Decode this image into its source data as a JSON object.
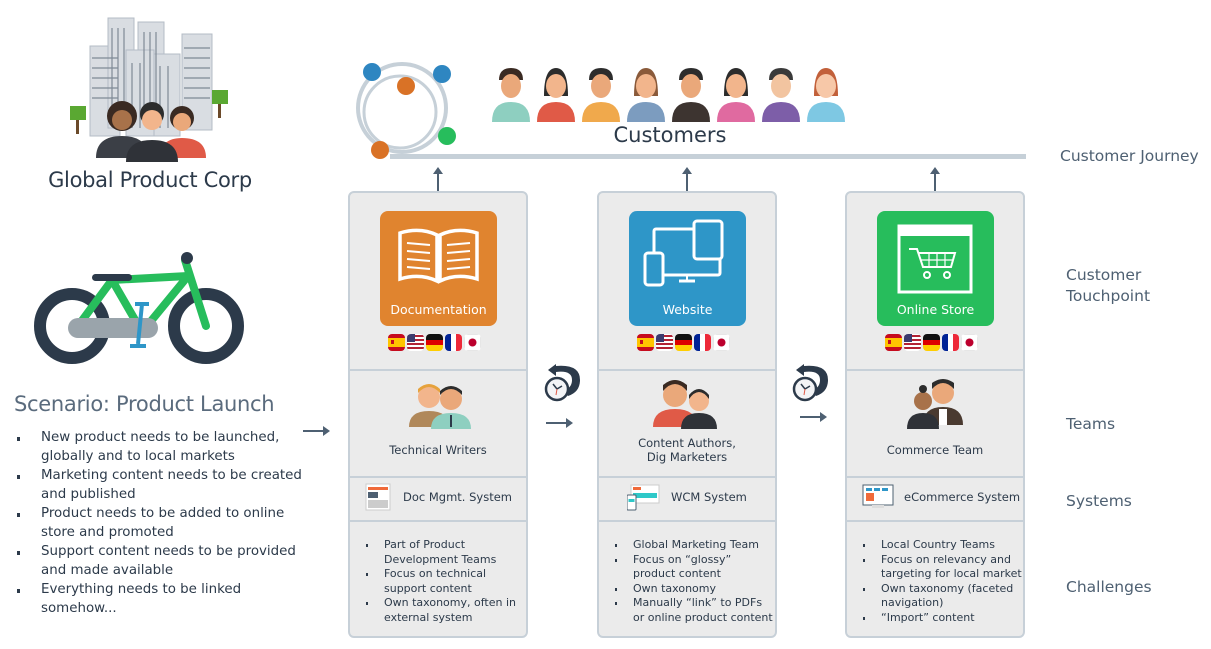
{
  "company": {
    "name": "Global Product Corp",
    "icon": "office-buildings-with-people"
  },
  "scenario": {
    "title": "Scenario: Product Launch",
    "icon": "bicycle",
    "bullets": [
      "New product needs to be launched, globally and to local markets",
      "Marketing content needs to be created and published",
      "Product needs to be added to online store and promoted",
      "Support content needs to be provided and made available",
      "Everything needs to be linked somehow..."
    ]
  },
  "customers": {
    "label": "Customers",
    "avatar_count": 8,
    "avatar_shirt_colors": [
      "#8ecfc0",
      "#e05a47",
      "#f0a94c",
      "#7c9cbf",
      "#3d3430",
      "#e06aa0",
      "#7d5ea8",
      "#7ec8e3"
    ]
  },
  "row_labels": {
    "journey": "Customer Journey",
    "touchpoint": "Customer Touchpoint",
    "teams": "Teams",
    "systems": "Systems",
    "challenges": "Challenges"
  },
  "flags": [
    "es",
    "us",
    "de",
    "fr",
    "jp"
  ],
  "columns": [
    {
      "touchpoint": "Documentation",
      "color": "#e0842f",
      "icon": "book-icon",
      "team": [
        "Technical Writers"
      ],
      "system": "Doc Mgmt. System",
      "system_icon": "document-icon",
      "challenges": [
        "Part of Product Development Teams",
        "Focus on technical support content",
        "Own taxonomy, often in external system"
      ]
    },
    {
      "touchpoint": "Website",
      "color": "#2e96c8",
      "icon": "devices-icon",
      "team": [
        "Content Authors,",
        "Dig Marketers"
      ],
      "system": "WCM System",
      "system_icon": "web-devices-icon",
      "challenges": [
        "Global Marketing Team",
        "Focus on “glossy” product content",
        "Own taxonomy",
        "Manually “link” to PDFs or online product content"
      ]
    },
    {
      "touchpoint": "Online Store",
      "color": "#27bd5c",
      "icon": "shopping-cart-icon",
      "team": [
        "Commerce Team"
      ],
      "system": "eCommerce System",
      "system_icon": "ecommerce-screen-icon",
      "challenges": [
        "Local  Country Teams",
        "Focus on relevancy and targeting for local market",
        "Own taxonomy (faceted navigation)",
        "“Import” content"
      ]
    }
  ]
}
